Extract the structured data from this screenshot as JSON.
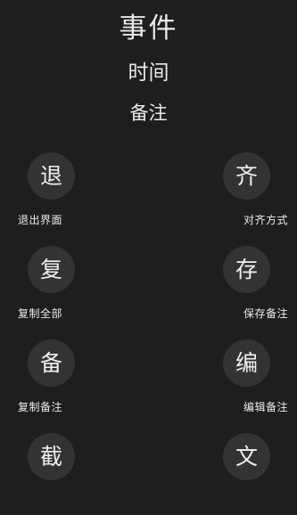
{
  "header": {
    "title": "事件",
    "time_label": "时间",
    "note_label": "备注"
  },
  "actions": [
    {
      "glyph": "退",
      "label": "退出界面"
    },
    {
      "glyph": "齐",
      "label": "对齐方式"
    },
    {
      "glyph": "复",
      "label": "复制全部"
    },
    {
      "glyph": "存",
      "label": "保存备注"
    },
    {
      "glyph": "备",
      "label": "复制备注"
    },
    {
      "glyph": "编",
      "label": "编辑备注"
    },
    {
      "glyph": "截",
      "label": ""
    },
    {
      "glyph": "文",
      "label": ""
    }
  ],
  "colors": {
    "background": "#1e1e1e",
    "button": "#333333",
    "text": "#e9e9e9"
  }
}
